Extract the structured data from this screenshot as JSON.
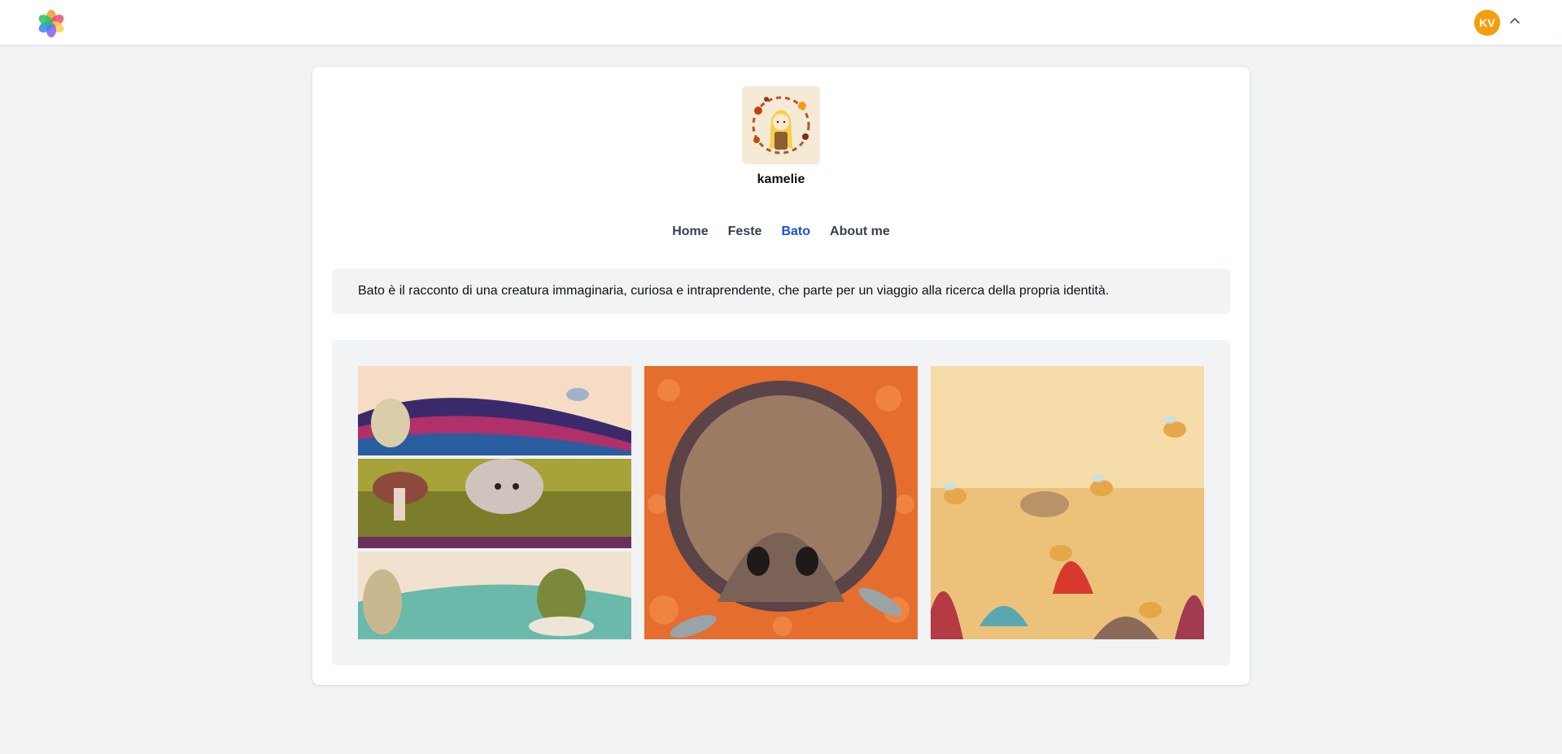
{
  "header": {
    "avatar_initials": "KV",
    "avatar_color": "#f59e0b",
    "logo_icon": "pinwheel-logo-icon",
    "menu_icon": "chevron-up-icon"
  },
  "profile": {
    "username": "kamelie",
    "picture_icon": "profile-illustration-icon"
  },
  "nav": {
    "items": [
      "Home",
      "Feste",
      "Bato",
      "About me"
    ],
    "active": "Bato",
    "active_color": "#1d4ed8"
  },
  "description": "Bato è il racconto di una creatura immaginaria, curiosa e intraprendente, che parte per un viaggio alla ricerca della propria identità.",
  "gallery": {
    "images": [
      {
        "icon": "illustration-landscape-triptych-icon"
      },
      {
        "icon": "illustration-hole-creature-icon"
      },
      {
        "icon": "illustration-bees-meadow-icon"
      }
    ]
  }
}
